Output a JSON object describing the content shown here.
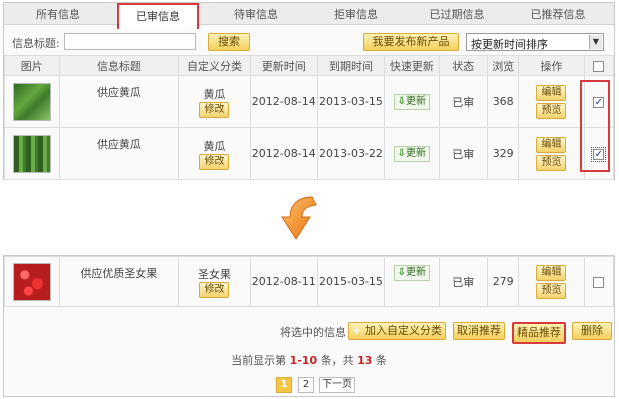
{
  "tabs": [
    "所有信息",
    "已审信息",
    "待审信息",
    "拒审信息",
    "已过期信息",
    "已推荐信息"
  ],
  "search": {
    "label": "信息标题:",
    "value": "",
    "search_button": "搜索",
    "publish_button": "我要发布新产品",
    "sort_selected": "按更新时间排序"
  },
  "table": {
    "headers": [
      "图片",
      "信息标题",
      "自定义分类",
      "更新时间",
      "到期时间",
      "快速更新",
      "状态",
      "浏览",
      "操作"
    ],
    "rows": [
      {
        "title": "供应黄瓜",
        "category": "黄瓜",
        "edit_label": "修改",
        "updated": "2012-08-14",
        "expires": "2013-03-15",
        "quick_update": "更新",
        "status": "已审",
        "views": "368",
        "op1": "编辑",
        "op2": "预览",
        "checked": "✓"
      },
      {
        "title": "供应黄瓜",
        "category": "黄瓜",
        "edit_label": "修改",
        "updated": "2012-08-14",
        "expires": "2013-03-22",
        "quick_update": "更新",
        "status": "已审",
        "views": "329",
        "op1": "编辑",
        "op2": "预览",
        "checked": "✓"
      }
    ]
  },
  "bottom": {
    "row": {
      "title": "供应优质圣女果",
      "category": "圣女果",
      "edit_label": "修改",
      "updated": "2012-08-11",
      "expires": "2015-03-15",
      "quick_update": "更新",
      "status": "已审",
      "views": "279",
      "op1": "编辑",
      "op2": "预览"
    },
    "actions_label": "将选中的信息",
    "add_category": "加入自定义分类",
    "cancel_recommend": "取消推荐",
    "featured_recommend": "精品推荐",
    "delete": "删除",
    "summary_prefix": "当前显示第",
    "summary_range": "1-10",
    "summary_mid": "条，共",
    "summary_total": "13",
    "summary_suffix": "条",
    "pages": [
      "1",
      "2"
    ],
    "next_page": "下一页"
  },
  "colors": {
    "accent_red": "#d63a3a",
    "button_yellow": "#f4cf5c",
    "arrow_orange": "#f08a1c"
  }
}
